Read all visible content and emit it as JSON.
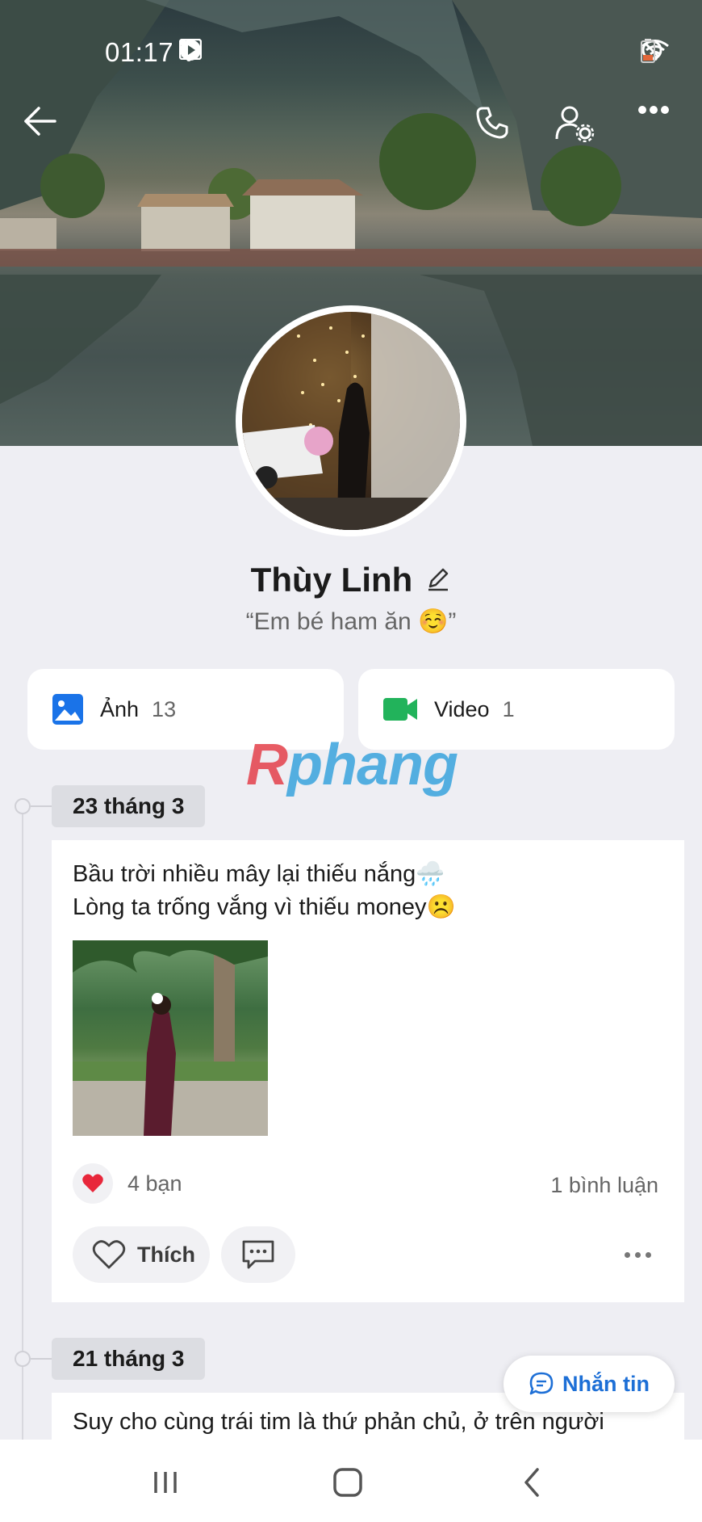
{
  "status_bar": {
    "time": "01:17"
  },
  "profile": {
    "name": "Thùy Linh",
    "bio": "“Em bé ham ăn ☺️”"
  },
  "media": [
    {
      "label": "Ảnh",
      "count": "13",
      "icon": "image-icon",
      "color": "#1a73e8"
    },
    {
      "label": "Video",
      "count": "1",
      "icon": "video-camera-icon",
      "color": "#22b35b"
    }
  ],
  "watermark": {
    "first": "R",
    "rest": "phang"
  },
  "posts": [
    {
      "date": "23 tháng 3",
      "line1": "Bầu trời nhiều mây lại thiếu nắng🌧️",
      "line2": "Lòng ta trống vắng vì thiếu money☹️",
      "reactions": "4 bạn",
      "comments": "1 bình luận",
      "like_label": "Thích"
    },
    {
      "date": "21 tháng 3",
      "text": "Suy cho cùng trái tim là thứ phản chủ, ở trên người"
    }
  ],
  "message_button": {
    "label": "Nhắn tin"
  },
  "colors": {
    "accent": "#1d6fd6",
    "heart": "#e8273b",
    "background": "#eeeef3"
  }
}
